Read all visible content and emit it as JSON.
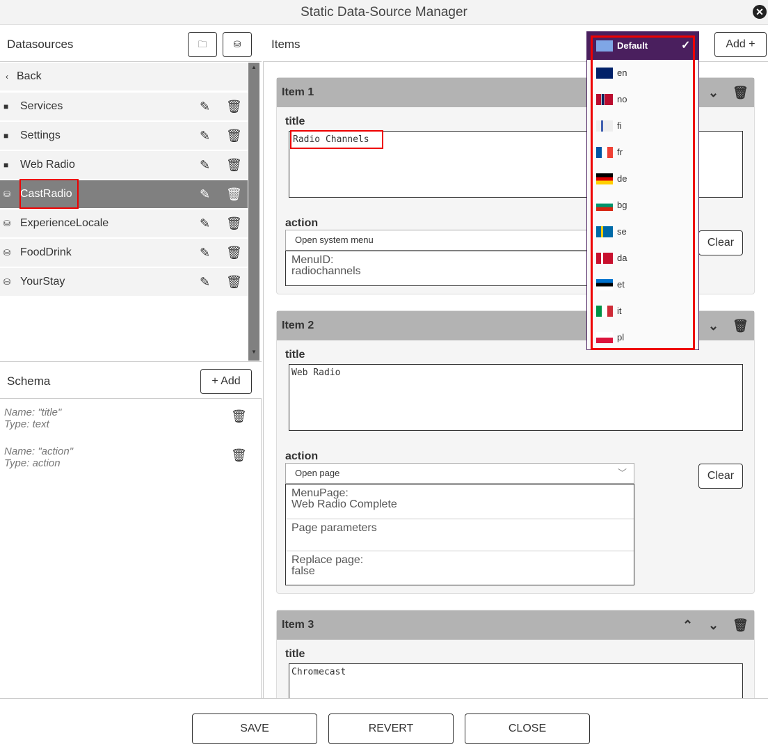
{
  "window": {
    "title": "Static Data-Source Manager"
  },
  "datasources": {
    "heading": "Datasources",
    "back": "Back",
    "items": [
      {
        "label": "Services",
        "type": "folder"
      },
      {
        "label": "Settings",
        "type": "folder"
      },
      {
        "label": "Web Radio",
        "type": "folder"
      },
      {
        "label": "CastRadio",
        "type": "datasource",
        "selected": true
      },
      {
        "label": "ExperienceLocale",
        "type": "datasource"
      },
      {
        "label": "FoodDrink",
        "type": "datasource"
      },
      {
        "label": "YourStay",
        "type": "datasource"
      }
    ]
  },
  "schema": {
    "heading": "Schema",
    "add_label": "+ Add",
    "fields": [
      {
        "name": "Name: \"title\"",
        "type": "Type: text"
      },
      {
        "name": "Name: \"action\"",
        "type": "Type: action"
      }
    ]
  },
  "items": {
    "heading": "Items",
    "add_label": "Add +",
    "cards": [
      {
        "title": "Item 1",
        "title_label": "title",
        "title_value": "Radio Channels",
        "action_label": "action",
        "action_value": "Open system menu",
        "props": [
          "MenuID:\nradiochannels"
        ],
        "clear": "Clear"
      },
      {
        "title": "Item 2",
        "title_label": "title",
        "title_value": "Web Radio",
        "action_label": "action",
        "action_value": "Open page",
        "props": [
          "MenuPage:\nWeb Radio Complete",
          "Page parameters",
          "Replace page:\nfalse"
        ],
        "clear": "Clear"
      },
      {
        "title": "Item 3",
        "title_label": "title",
        "title_value": "Chromecast"
      }
    ]
  },
  "language_dropdown": {
    "selected": "Default",
    "options": [
      "en",
      "no",
      "fi",
      "fr",
      "de",
      "bg",
      "se",
      "da",
      "et",
      "it",
      "pl"
    ]
  },
  "footer": {
    "save": "SAVE",
    "revert": "REVERT",
    "close": "CLOSE"
  },
  "colors": {
    "accent": "#4a1f5e",
    "highlight": "#e00000",
    "selected_row": "#808080"
  }
}
